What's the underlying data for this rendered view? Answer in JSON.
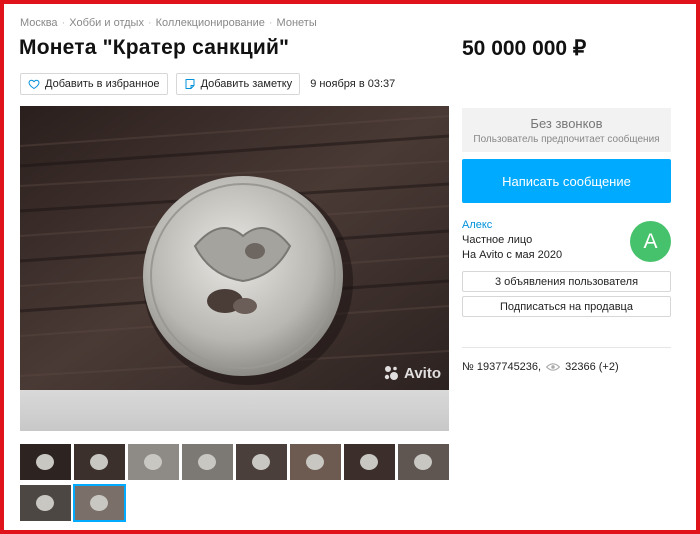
{
  "breadcrumbs": [
    "Москва",
    "Хобби и отдых",
    "Коллекционирование",
    "Монеты"
  ],
  "breadcrumb_sep": "·",
  "title": "Монета \"Кратер санкций\"",
  "price": "50 000 000 ₽",
  "actions": {
    "favorite": "Добавить в избранное",
    "note": "Добавить заметку",
    "date": "9 ноября в 03:37"
  },
  "gallery": {
    "watermark": "Avito",
    "thumbnail_count": 10,
    "active_thumbnail": 9
  },
  "contact": {
    "no_calls_title": "Без звонков",
    "no_calls_sub": "Пользователь предпочитает сообщения",
    "write_button": "Написать сообщение"
  },
  "seller": {
    "name": "Алекс",
    "type": "Частное лицо",
    "since": "На Avito с мая 2020",
    "avatar_letter": "А",
    "ads_button": "3 объявления пользователя",
    "subscribe_button": "Подписаться на продавца"
  },
  "meta": {
    "ad_number": "№ 1937745236,",
    "views": "32366 (+2)"
  },
  "colors": {
    "accent": "#00aaff",
    "avatar": "#47c26c",
    "frame": "#e0131a",
    "link": "#0091d9"
  }
}
